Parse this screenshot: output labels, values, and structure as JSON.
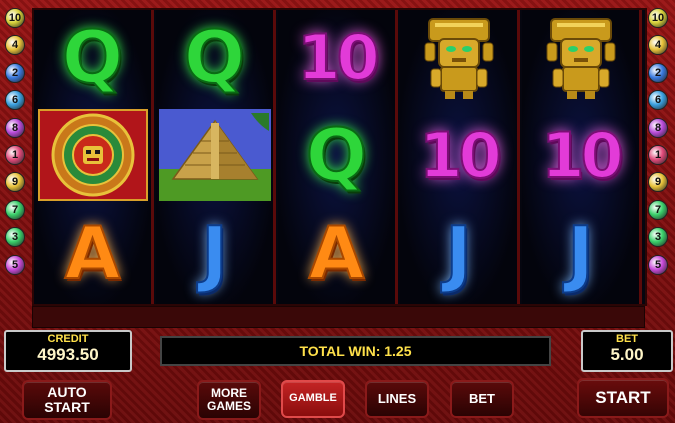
{
  "reels": [
    {
      "symbols": [
        {
          "type": "Q",
          "name": "q-symbol",
          "text": "Q"
        },
        {
          "type": "calendar",
          "name": "aztec-calendar-symbol"
        },
        {
          "type": "A",
          "name": "a-symbol",
          "text": "A"
        }
      ]
    },
    {
      "symbols": [
        {
          "type": "Q",
          "name": "q-symbol",
          "text": "Q"
        },
        {
          "type": "pyramid",
          "name": "pyramid-symbol"
        },
        {
          "type": "J",
          "name": "j-symbol",
          "text": "J"
        }
      ]
    },
    {
      "symbols": [
        {
          "type": "10",
          "name": "ten-symbol",
          "text": "10"
        },
        {
          "type": "Q",
          "name": "q-symbol",
          "text": "Q"
        },
        {
          "type": "A",
          "name": "a-symbol",
          "text": "A"
        }
      ]
    },
    {
      "symbols": [
        {
          "type": "idol",
          "name": "golden-idol-symbol"
        },
        {
          "type": "10",
          "name": "ten-symbol",
          "text": "10"
        },
        {
          "type": "J",
          "name": "j-symbol",
          "text": "J"
        }
      ]
    },
    {
      "symbols": [
        {
          "type": "idol",
          "name": "golden-idol-symbol"
        },
        {
          "type": "10",
          "name": "ten-symbol",
          "text": "10"
        },
        {
          "type": "J",
          "name": "j-symbol",
          "text": "J"
        }
      ]
    }
  ],
  "line_numbers_left": [
    {
      "n": "10",
      "color": "#d8d23a"
    },
    {
      "n": "4",
      "color": "#e8c23a"
    },
    {
      "n": "2",
      "color": "#3a7ae0"
    },
    {
      "n": "6",
      "color": "#3aa0e0"
    },
    {
      "n": "8",
      "color": "#b84ad8"
    },
    {
      "n": "1",
      "color": "#e04a7a"
    },
    {
      "n": "9",
      "color": "#e8c23a"
    },
    {
      "n": "7",
      "color": "#3ad06a"
    },
    {
      "n": "3",
      "color": "#3ad06a"
    },
    {
      "n": "5",
      "color": "#c84ad8"
    }
  ],
  "line_numbers_right": [
    {
      "n": "10",
      "color": "#d8d23a"
    },
    {
      "n": "4",
      "color": "#e8c23a"
    },
    {
      "n": "2",
      "color": "#3a7ae0"
    },
    {
      "n": "6",
      "color": "#3aa0e0"
    },
    {
      "n": "8",
      "color": "#b84ad8"
    },
    {
      "n": "1",
      "color": "#e04a7a"
    },
    {
      "n": "9",
      "color": "#e8c23a"
    },
    {
      "n": "7",
      "color": "#3ad06a"
    },
    {
      "n": "3",
      "color": "#3ad06a"
    },
    {
      "n": "5",
      "color": "#c84ad8"
    }
  ],
  "credit": {
    "label": "CREDIT",
    "value": "4993.50"
  },
  "bet_panel": {
    "label": "BET",
    "value": "5.00"
  },
  "total_win": "TOTAL WIN: 1.25",
  "buttons": {
    "auto_start": "AUTO START",
    "more_games": "MORE GAMES",
    "gamble": "GAMBLE",
    "lines": "LINES",
    "bet": "BET",
    "start": "START"
  }
}
